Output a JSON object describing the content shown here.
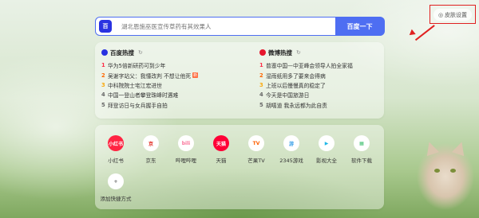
{
  "toolbar": {
    "settings_label": "皮肤设置"
  },
  "search": {
    "logo_text": "百",
    "placeholder": "湖北恩施巫医宣传草药有其效果人",
    "button_label": "百度一下"
  },
  "hot": {
    "baidu": {
      "title": "百度热搜",
      "items": [
        {
          "rank": "1",
          "text": "华为5倍新研药可到少年",
          "rank_color": "#fe2d46"
        },
        {
          "rank": "2",
          "text": "吴谢字站父：我懂改判 不想让他死",
          "rank_color": "#ff6600",
          "tag": "新"
        },
        {
          "rank": "3",
          "text": "中科院院士宅江宏进世",
          "rank_color": "#faa90e"
        },
        {
          "rank": "4",
          "text": "中国一登山者攀登珠峰时遇难",
          "rank_color": "#666666"
        },
        {
          "rank": "5",
          "text": "拜登访日与女兵握手自拍",
          "rank_color": "#666666"
        }
      ]
    },
    "weibo": {
      "title": "微博热搜",
      "items": [
        {
          "rank": "1",
          "text": "普塞中国—中亚峰会领导人拍全家福",
          "rank_color": "#fe2d46"
        },
        {
          "rank": "2",
          "text": "湿雨纸用多了要来会得病",
          "rank_color": "#ff6600"
        },
        {
          "rank": "3",
          "text": "上班以后慢慢真的稳定了",
          "rank_color": "#faa90e"
        },
        {
          "rank": "4",
          "text": "今天是中国旅游日",
          "rank_color": "#666666"
        },
        {
          "rank": "5",
          "text": "胡嘻道 我永远都为此自责",
          "rank_color": "#666666"
        }
      ]
    }
  },
  "apps": [
    {
      "label": "小红书",
      "icon": "小红书",
      "color": "#ff2442",
      "text_color": "#ffffff"
    },
    {
      "label": "京东",
      "icon": "京",
      "color": "#ffffff",
      "text_color": "#e1251b"
    },
    {
      "label": "哔哩哔哩",
      "icon": "bili",
      "color": "#ffffff",
      "text_color": "#fb7299"
    },
    {
      "label": "天猫",
      "icon": "天猫",
      "color": "#ff0036",
      "text_color": "#ffffff"
    },
    {
      "label": "芒果TV",
      "icon": "TV",
      "color": "#ffffff",
      "text_color": "#ff5f00"
    },
    {
      "label": "2345游戏",
      "icon": "游",
      "color": "#ffffff",
      "text_color": "#3aa0e8"
    },
    {
      "label": "影视大全",
      "icon": "▶",
      "color": "#ffffff",
      "text_color": "#1fb7e8"
    },
    {
      "label": "软件下载",
      "icon": "▦",
      "color": "#ffffff",
      "text_color": "#3fbf6f"
    },
    {
      "label": "添加快捷方式",
      "icon": "+",
      "color": "#ffffff",
      "text_color": "#666666"
    }
  ]
}
